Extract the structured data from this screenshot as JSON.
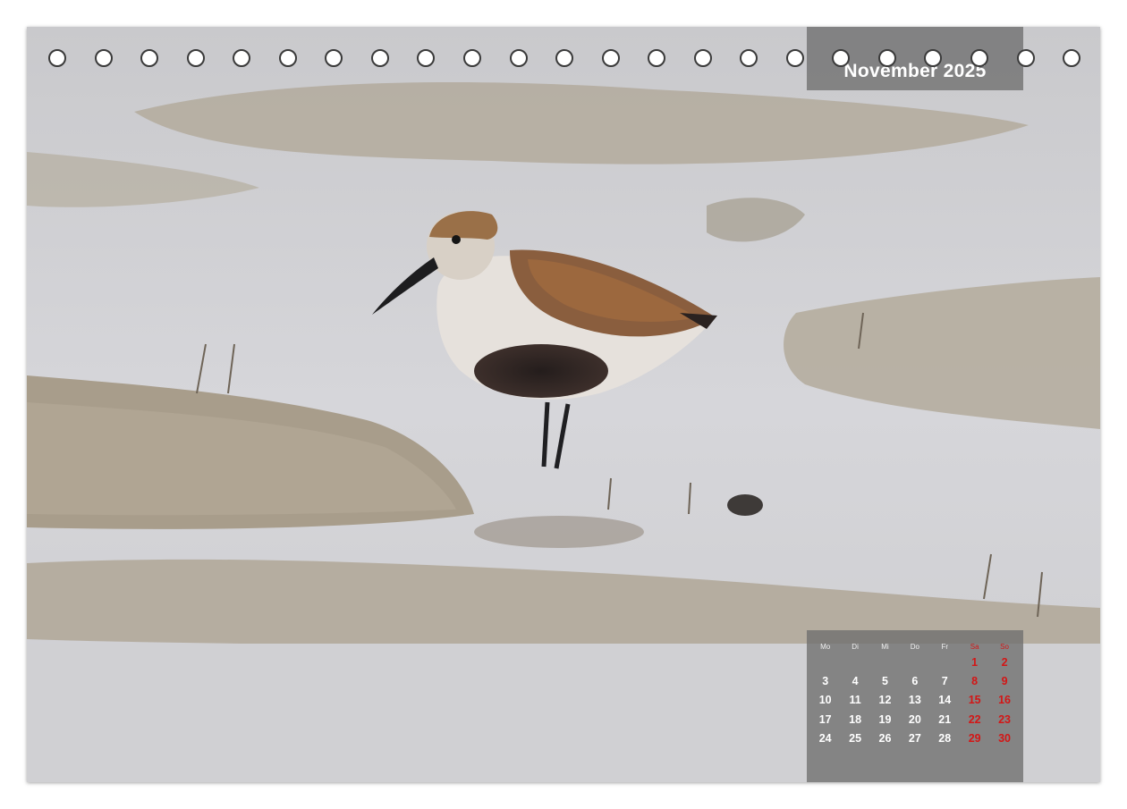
{
  "calendar_page": {
    "month_title": "November 2025",
    "weekday_headers": [
      "Mo",
      "Di",
      "Mi",
      "Do",
      "Fr",
      "Sa",
      "So"
    ],
    "weeks": [
      [
        "",
        "",
        "",
        "",
        "",
        "1",
        "2"
      ],
      [
        "3",
        "4",
        "5",
        "6",
        "7",
        "8",
        "9"
      ],
      [
        "10",
        "11",
        "12",
        "13",
        "14",
        "15",
        "16"
      ],
      [
        "17",
        "18",
        "19",
        "20",
        "21",
        "22",
        "23"
      ],
      [
        "24",
        "25",
        "26",
        "27",
        "28",
        "29",
        "30"
      ]
    ],
    "weekend_color": "#d31616",
    "binding_hole_count": 23
  },
  "photo": {
    "subject_icon": "sandpiper-bird-icon"
  }
}
